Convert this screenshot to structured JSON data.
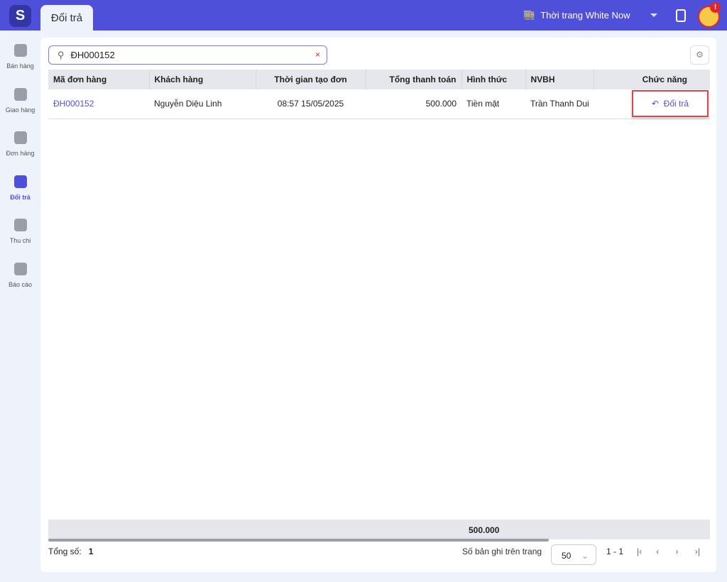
{
  "header": {
    "tab": "Đổi trả",
    "shop": "Thời trang White Now",
    "notification_badge": "!"
  },
  "sidebar": [
    {
      "label": "Bán hàng"
    },
    {
      "label": "Giao hàng"
    },
    {
      "label": "Đơn hàng"
    },
    {
      "label": "Đổi trả"
    },
    {
      "label": "Thu chi"
    },
    {
      "label": "Báo cáo"
    }
  ],
  "search": {
    "value": "ĐH000152",
    "clear": "×"
  },
  "table": {
    "headers": [
      "Mã đơn hàng",
      "Khách hàng",
      "Thời gian tạo đơn",
      "Tổng thanh toán",
      "Hình thức",
      "NVBH",
      "Chức năng"
    ],
    "rows": [
      {
        "code": "ĐH000152",
        "customer": "Nguyễn Diệu Linh",
        "time": "08:57 15/05/2025",
        "total": "500.000",
        "method": "Tiền mặt",
        "staff": "Trần Thanh Dui",
        "action": "Đổi trả"
      }
    ],
    "sum_total": "500.000"
  },
  "footer": {
    "total_label": "Tổng số:",
    "total": "1",
    "per_page_label": "Số bản ghi trên trang",
    "per_page": "50",
    "range": "1 - 1"
  }
}
